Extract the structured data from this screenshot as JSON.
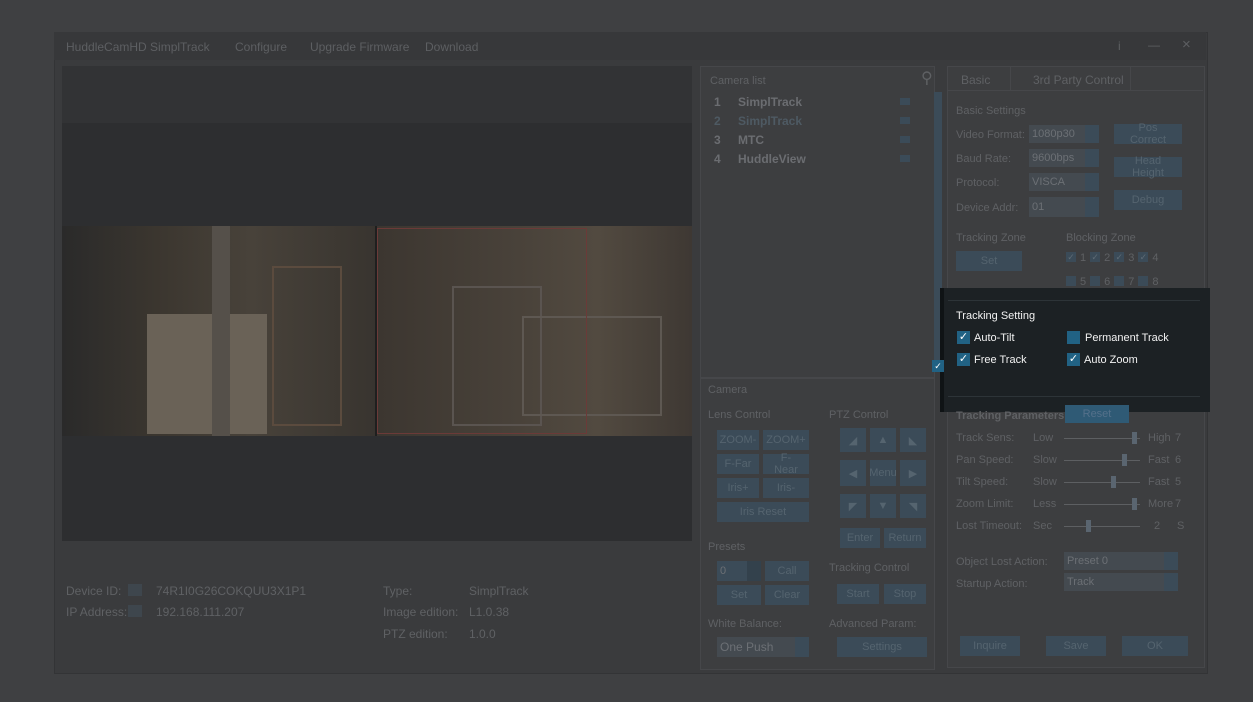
{
  "titlebar": {
    "app_name": "HuddleCamHD SimplTrack",
    "menu": [
      "Configure",
      "Upgrade Firmware",
      "Download"
    ],
    "info": "i",
    "minimize": "—",
    "close": "×"
  },
  "camera_list": {
    "header": "Camera list",
    "items": [
      {
        "num": "1",
        "name": "SimplTrack"
      },
      {
        "num": "2",
        "name": "SimplTrack"
      },
      {
        "num": "3",
        "name": "MTC"
      },
      {
        "num": "4",
        "name": "HuddleView"
      }
    ]
  },
  "tabs": {
    "basic": "Basic",
    "third_party": "3rd Party Control"
  },
  "basic": {
    "header": "Basic Settings",
    "video_format_label": "Video Format:",
    "video_format": "1080p30",
    "baud_rate_label": "Baud Rate:",
    "baud_rate": "9600bps",
    "protocol_label": "Protocol:",
    "protocol": "VISCA",
    "device_addr_label": "Device Addr:",
    "device_addr": "01",
    "pos_correct": "Pos Correct",
    "head_height": "Head Height",
    "debug": "Debug",
    "tracking_zone": "Tracking Zone",
    "set": "Set",
    "blocking_zone": "Blocking Zone",
    "zones_row1": [
      "1",
      "2",
      "3",
      "4"
    ],
    "zones_row2": [
      "5",
      "6",
      "7",
      "8"
    ]
  },
  "tracking_setting": {
    "header": "Tracking Setting",
    "auto_tilt": "Auto-Tilt",
    "permanent_track": "Permanent Track",
    "free_track": "Free Track",
    "auto_zoom": "Auto Zoom"
  },
  "tracking_params": {
    "header": "Tracking Parameters",
    "reset": "Reset",
    "rows": [
      {
        "label": "Track Sens:",
        "low": "Low",
        "high": "High",
        "value": "7",
        "level": 0.95
      },
      {
        "label": "Pan Speed:",
        "low": "Slow",
        "high": "Fast",
        "value": "6",
        "level": 0.8
      },
      {
        "label": "Tilt Speed:",
        "low": "Slow",
        "high": "Fast",
        "value": "5",
        "level": 0.65
      },
      {
        "label": "Zoom Limit:",
        "low": "Less",
        "high": "More",
        "value": "7",
        "level": 0.95
      },
      {
        "label": "Lost Timeout:",
        "low": "Sec",
        "high": "2",
        "value": "S",
        "level": 0.3
      }
    ],
    "object_lost_label": "Object Lost Action:",
    "object_lost": "Preset 0",
    "startup_label": "Startup Action:",
    "startup": "Track"
  },
  "camera": {
    "header": "Camera",
    "lens_control": "Lens Control",
    "zoom_minus": "ZOOM-",
    "zoom_plus": "ZOOM+",
    "f_far": "F-Far",
    "f_near": "F-Near",
    "iris_plus": "Iris+",
    "iris_minus": "Iris-",
    "iris_reset": "Iris Reset",
    "ptz_control": "PTZ Control",
    "menu": "Menu",
    "enter": "Enter",
    "return": "Return",
    "presets": "Presets",
    "preset_value": "0",
    "call": "Call",
    "set": "Set",
    "clear": "Clear",
    "tracking_control": "Tracking Control",
    "start": "Start",
    "stop": "Stop",
    "white_balance": "White Balance:",
    "wb_value": "One Push",
    "advanced_param": "Advanced Param:",
    "settings": "Settings"
  },
  "device": {
    "id_label": "Device ID:",
    "id": "74R1I0G26COKQUU3X1P1",
    "ip_label": "IP Address:",
    "ip": "192.168.111.207",
    "type_label": "Type:",
    "type": "SimplTrack",
    "image_label": "Image edition:",
    "image": "L1.0.38",
    "ptz_label": "PTZ edition:",
    "ptz": "1.0.0"
  },
  "footer": {
    "inquire": "Inquire",
    "save": "Save",
    "ok": "OK"
  }
}
